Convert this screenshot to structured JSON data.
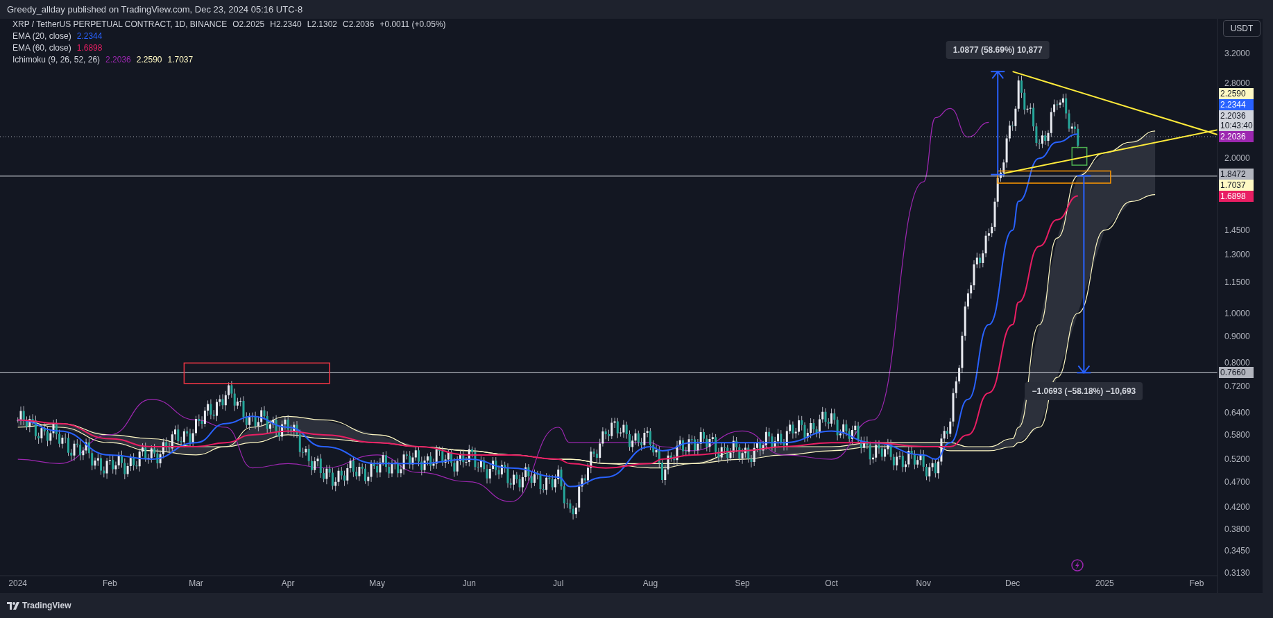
{
  "header": {
    "text": "Greedy_allday published on TradingView.com, Dec 23, 2024 05:16 UTC-8"
  },
  "legend": {
    "title": "XRP / TetherUS PERPETUAL CONTRACT, 1D, BINANCE",
    "ohlc": [
      "O2.2025",
      "H2.2340",
      "L2.1302",
      "C2.2036"
    ],
    "change": "+0.0011 (+0.05%)",
    "indicators": [
      {
        "name": "EMA (20, close)",
        "values": [
          {
            "text": "2.2344",
            "color": "#2962ff"
          }
        ]
      },
      {
        "name": "EMA (60, close)",
        "values": [
          {
            "text": "1.6898",
            "color": "#e91e63"
          }
        ]
      },
      {
        "name": "Ichimoku (9, 26, 52, 26)",
        "values": [
          {
            "text": "2.2036",
            "color": "#9c27b0"
          },
          {
            "text": "2.2590",
            "color": "#fff9c4"
          },
          {
            "text": "1.7037",
            "color": "#fff9c4"
          }
        ]
      }
    ]
  },
  "currency_button": "USDT",
  "price_axis": [
    "3.2000",
    "2.8000",
    "2.0000",
    "1.4500",
    "1.3000",
    "1.1500",
    "1.0000",
    "0.9000",
    "0.8000",
    "0.7200",
    "0.6400",
    "0.5800",
    "0.5200",
    "0.4700",
    "0.4200",
    "0.3800",
    "0.3450",
    "0.3130"
  ],
  "time_axis": [
    "2024",
    "Feb",
    "Mar",
    "Apr",
    "May",
    "Jun",
    "Jul",
    "Aug",
    "Sep",
    "Oct",
    "Nov",
    "Dec",
    "2025",
    "Feb"
  ],
  "measurements": [
    {
      "label": "1.0877 (58.69%) 10,877"
    },
    {
      "label": "−1.0693 (−58.18%) −10,693"
    }
  ],
  "price_tags": [
    {
      "kind": "value",
      "text": "2.2590",
      "color": "#fff9c4"
    },
    {
      "kind": "value",
      "text": "2.2344",
      "color": "#2962ff"
    },
    {
      "kind": "countdown",
      "text": "2.2036",
      "countdown": "10:43:40",
      "color": "#d1d4dc"
    },
    {
      "kind": "value",
      "text": "2.2036",
      "color": "#9c27b0"
    },
    {
      "kind": "line",
      "text": "1.8472",
      "color": "#b2b5be"
    },
    {
      "kind": "value",
      "text": "1.7037",
      "color": "#fff9c4"
    },
    {
      "kind": "value",
      "text": "1.6898",
      "color": "#e91e63"
    },
    {
      "kind": "line",
      "text": "0.7660",
      "color": "#b2b5be"
    }
  ],
  "footer": {
    "brand": "TradingView"
  }
}
